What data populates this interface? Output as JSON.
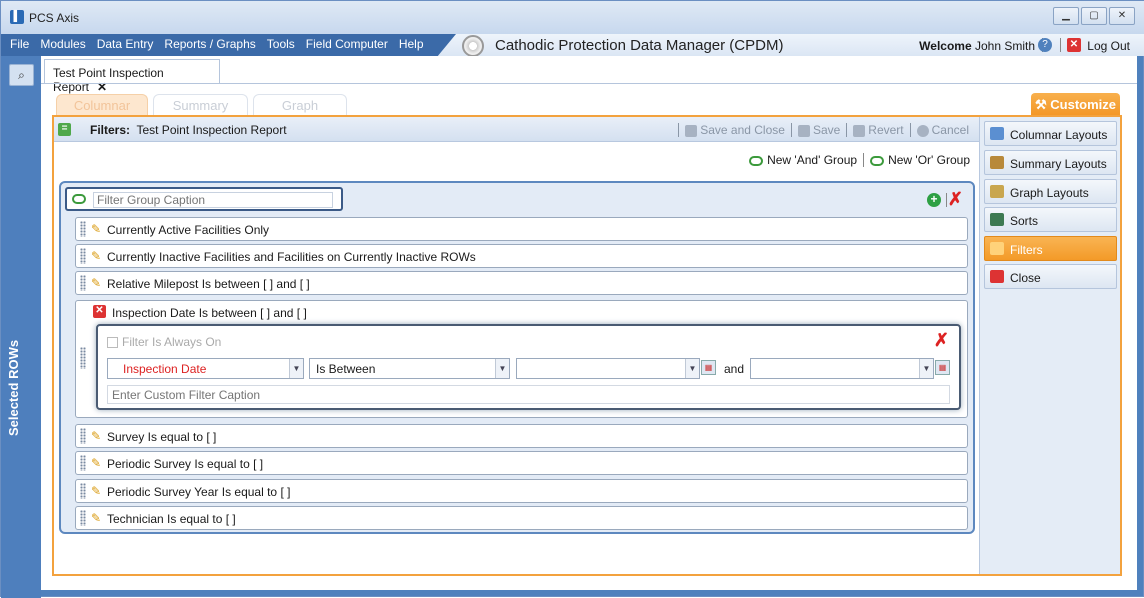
{
  "window": {
    "title": "PCS Axis",
    "logo": "pcs-logo"
  },
  "menu": {
    "items": [
      "File",
      "Modules",
      "Data Entry",
      "Reports / Graphs",
      "Tools",
      "Field Computer",
      "Help"
    ],
    "app_title": "Cathodic Protection Data Manager (CPDM)",
    "welcome": "Welcome",
    "user": "John Smith",
    "logout": "Log Out"
  },
  "left_rail": {
    "label": "Selected ROWs"
  },
  "document_tab": {
    "label": "Test Point Inspection Report",
    "close": "✕"
  },
  "view_tabs": [
    "Columnar",
    "Summary",
    "Graph"
  ],
  "customize_label": "Customize",
  "filters_header": {
    "label": "Filters:",
    "report_name": "Test Point Inspection Report",
    "actions": [
      "Save and Close",
      "Save",
      "Revert",
      "Cancel"
    ]
  },
  "group_links": {
    "and_group": "New 'And' Group",
    "or_group": "New 'Or' Group"
  },
  "filter_group": {
    "caption_placeholder": "Filter Group Caption",
    "filters_top": [
      "Currently Active Facilities Only",
      "Currently Inactive Facilities and Facilities on Currently Inactive ROWs",
      "Relative Milepost Is between [           ] and [           ]"
    ],
    "expanded": {
      "text": "Inspection Date Is between [           ] and [           ]",
      "always_on": "Filter Is Always On",
      "field": "Inspection Date",
      "operator": "Is Between",
      "and_label": "and",
      "custom_caption_placeholder": "Enter Custom Filter Caption"
    },
    "filters_bottom": [
      "Survey Is equal to [           ]",
      "Periodic Survey Is equal to [           ]",
      "Periodic Survey Year Is equal to [           ]",
      "Technician Is equal to [           ]"
    ]
  },
  "side_panel": {
    "items": [
      {
        "label": "Columnar Layouts",
        "icon": "grid-icon"
      },
      {
        "label": "Summary Layouts",
        "icon": "summary-icon"
      },
      {
        "label": "Graph Layouts",
        "icon": "chart-icon"
      },
      {
        "label": "Sorts",
        "icon": "sort-icon"
      },
      {
        "label": "Filters",
        "icon": "filter-icon",
        "active": true
      },
      {
        "label": "Close",
        "icon": "close-icon"
      }
    ]
  },
  "colors": {
    "accent": "#f39a28",
    "frame": "#4f81bd",
    "danger": "#d33333"
  }
}
